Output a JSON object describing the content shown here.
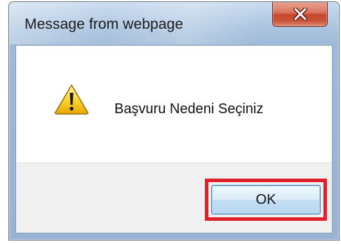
{
  "dialog": {
    "title": "Message from webpage",
    "message": "Başvuru Nedeni Seçiniz",
    "ok_label": "OK",
    "icon": "warning-icon",
    "close_icon": "close-icon"
  },
  "colors": {
    "highlight_border": "#e0202a",
    "close_button": "#c7462c",
    "title_bar": "#b9cfe7",
    "footer": "#f0f0f0"
  }
}
